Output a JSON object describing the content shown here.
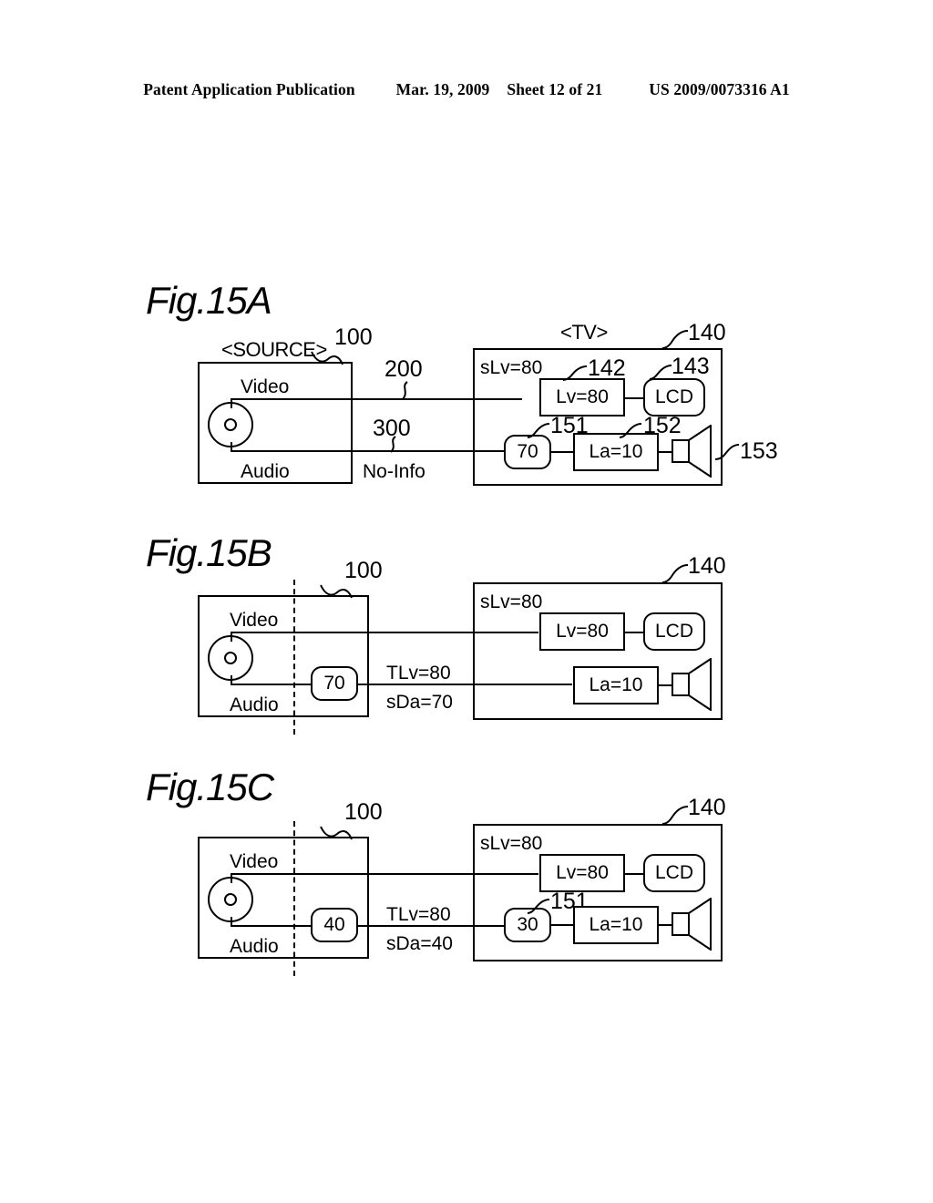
{
  "header": {
    "publication": "Patent Application Publication",
    "date": "Mar. 19, 2009",
    "sheet": "Sheet 12 of 21",
    "patent_number": "US 2009/0073316 A1"
  },
  "figures": [
    {
      "id": "fig15a",
      "label": "Fig.15A",
      "source": {
        "title": "<SOURCE>",
        "ref": "100",
        "video_label": "Video",
        "audio_label": "Audio",
        "disc_icon": "optical-disc-icon"
      },
      "cables": {
        "video_ref": "200",
        "audio_ref": "300",
        "audio_note": "No-Info"
      },
      "tv": {
        "title": "<TV>",
        "ref": "140",
        "slv": "sLv=80",
        "video_amp": {
          "label": "Lv=80",
          "ref": "142"
        },
        "display": {
          "label": "LCD",
          "ref": "143"
        },
        "vol_node": {
          "label": "70",
          "ref": "151"
        },
        "audio_amp": {
          "label": "La=10",
          "ref": "152"
        },
        "speaker": {
          "ref": "153",
          "icon": "speaker-icon"
        }
      }
    },
    {
      "id": "fig15b",
      "label": "Fig.15B",
      "source": {
        "ref": "100",
        "video_label": "Video",
        "audio_label": "Audio",
        "vol_node": "70",
        "disc_icon": "optical-disc-icon"
      },
      "cables": {
        "tlv": "TLv=80",
        "sda": "sDa=70"
      },
      "tv": {
        "ref": "140",
        "slv": "sLv=80",
        "video_amp": {
          "label": "Lv=80"
        },
        "display": {
          "label": "LCD"
        },
        "audio_amp": {
          "label": "La=10"
        },
        "speaker": {
          "icon": "speaker-icon"
        }
      }
    },
    {
      "id": "fig15c",
      "label": "Fig.15C",
      "source": {
        "ref": "100",
        "video_label": "Video",
        "audio_label": "Audio",
        "vol_node": "40",
        "disc_icon": "optical-disc-icon"
      },
      "cables": {
        "tlv": "TLv=80",
        "sda": "sDa=40"
      },
      "tv": {
        "ref": "140",
        "slv": "sLv=80",
        "video_amp": {
          "label": "Lv=80"
        },
        "display": {
          "label": "LCD"
        },
        "vol_node": {
          "label": "30",
          "ref": "151"
        },
        "audio_amp": {
          "label": "La=10"
        },
        "speaker": {
          "icon": "speaker-icon"
        }
      }
    }
  ]
}
